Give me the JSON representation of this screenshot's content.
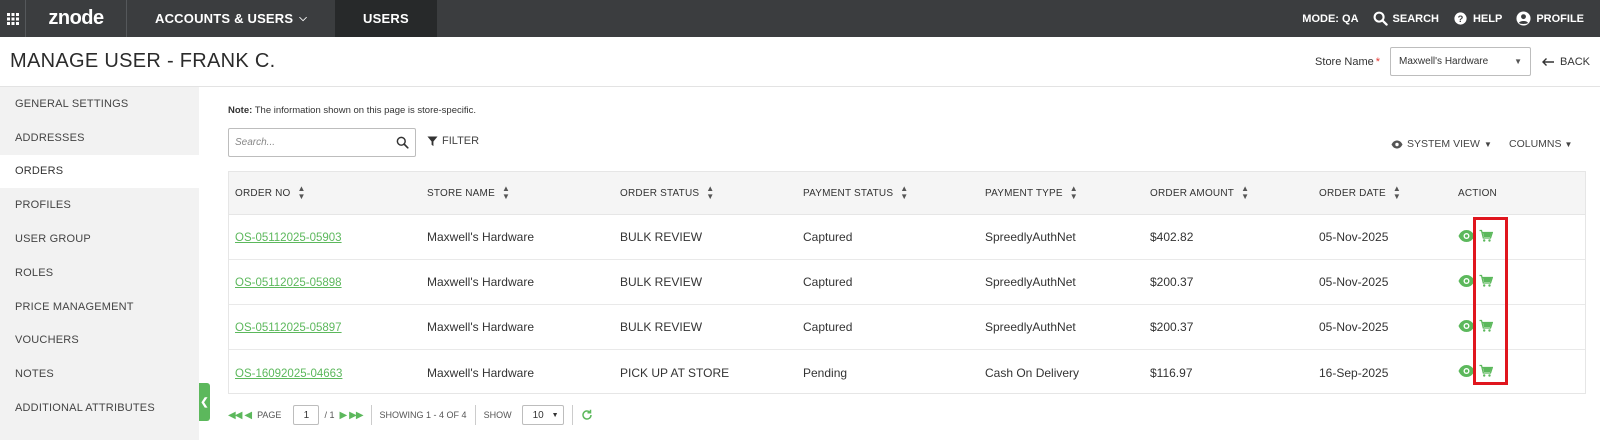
{
  "topnav": {
    "brand": "znode",
    "menu": [
      {
        "label": "ACCOUNTS & USERS",
        "has_dropdown": true
      },
      {
        "label": "USERS",
        "active": true
      }
    ],
    "mode": "MODE: QA",
    "search": "SEARCH",
    "help": "HELP",
    "profile": "PROFILE"
  },
  "header": {
    "title": "MANAGE USER - FRANK C.",
    "store_label": "Store Name",
    "store_required": "*",
    "store_value": "Maxwell's Hardware",
    "back": "BACK"
  },
  "sidebar": {
    "items": [
      {
        "label": "GENERAL SETTINGS"
      },
      {
        "label": "ADDRESSES"
      },
      {
        "label": "ORDERS",
        "active": true
      },
      {
        "label": "PROFILES"
      },
      {
        "label": "USER GROUP"
      },
      {
        "label": "ROLES"
      },
      {
        "label": "PRICE MANAGEMENT"
      },
      {
        "label": "VOUCHERS"
      },
      {
        "label": "NOTES"
      },
      {
        "label": "ADDITIONAL ATTRIBUTES"
      }
    ]
  },
  "main": {
    "note_prefix": "Note:",
    "note_text": " The information shown on this page is store-specific.",
    "search_placeholder": "Search...",
    "filter": "FILTER",
    "system_view": "SYSTEM VIEW",
    "columns": "COLUMNS"
  },
  "table": {
    "headers": [
      "ORDER NO",
      "STORE NAME",
      "ORDER STATUS",
      "PAYMENT STATUS",
      "PAYMENT TYPE",
      "ORDER AMOUNT",
      "ORDER DATE",
      "ACTION"
    ],
    "rows": [
      {
        "order_no": "OS-05112025-05903",
        "store": "Maxwell's Hardware",
        "status": "BULK REVIEW",
        "payment_status": "Captured",
        "payment_type": "SpreedlyAuthNet",
        "amount": "$402.82",
        "date": "05-Nov-2025"
      },
      {
        "order_no": "OS-05112025-05898",
        "store": "Maxwell's Hardware",
        "status": "BULK REVIEW",
        "payment_status": "Captured",
        "payment_type": "SpreedlyAuthNet",
        "amount": "$200.37",
        "date": "05-Nov-2025"
      },
      {
        "order_no": "OS-05112025-05897",
        "store": "Maxwell's Hardware",
        "status": "BULK REVIEW",
        "payment_status": "Captured",
        "payment_type": "SpreedlyAuthNet",
        "amount": "$200.37",
        "date": "05-Nov-2025"
      },
      {
        "order_no": "OS-16092025-04663",
        "store": "Maxwell's Hardware",
        "status": "PICK UP AT STORE",
        "payment_status": "Pending",
        "payment_type": "Cash On Delivery",
        "amount": "$116.97",
        "date": "16-Sep-2025"
      }
    ]
  },
  "pager": {
    "page_label": "PAGE",
    "page_value": "1",
    "page_total": "/ 1",
    "showing": "SHOWING 1 - 4 OF 4",
    "show_label": "SHOW",
    "show_value": "10"
  },
  "colors": {
    "nav_bg": "#3b3d3f",
    "accent_green": "#5cb85c",
    "highlight_red": "#e0161e"
  }
}
